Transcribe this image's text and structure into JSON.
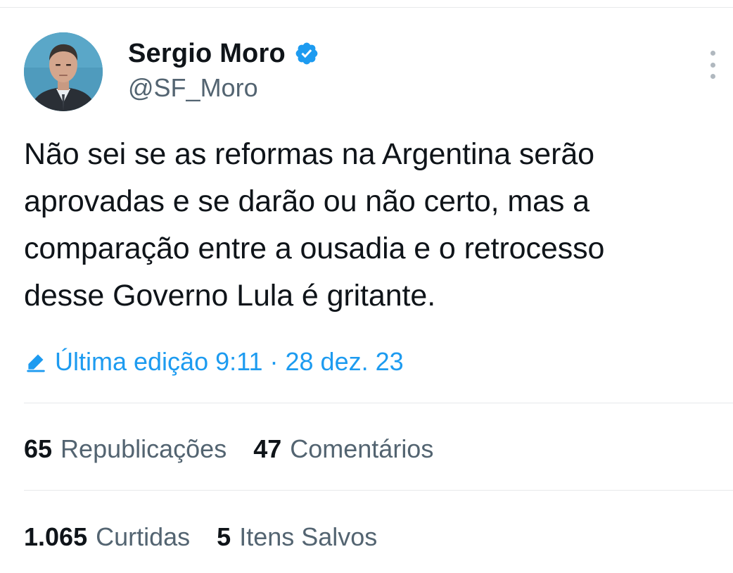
{
  "author": {
    "display_name": "Sergio Moro",
    "handle": "@SF_Moro",
    "verified": true
  },
  "tweet": {
    "text_lines": [
      "Não sei se as reformas na Argentina serão",
      "aprovadas e se darão ou não certo, mas a",
      "comparação entre a ousadia e o retrocesso",
      "desse Governo Lula é gritante."
    ],
    "edit_label": "Última edição",
    "time": "9:11",
    "separator": "·",
    "date": "28 dez. 23"
  },
  "stats": {
    "reposts_count": "65",
    "reposts_label": "Republicações",
    "replies_count": "47",
    "replies_label": "Comentários",
    "likes_count": "1.065",
    "likes_label": "Curtidas",
    "bookmarks_count": "5",
    "bookmarks_label": "Itens Salvos"
  },
  "icons": {
    "verified": "verified-badge-icon",
    "more": "more-options-icon",
    "edit": "pencil-icon"
  },
  "colors": {
    "accent": "#1d9bf0",
    "text_primary": "#0f1419",
    "text_secondary": "#536471",
    "divider": "#e7e9ea"
  }
}
